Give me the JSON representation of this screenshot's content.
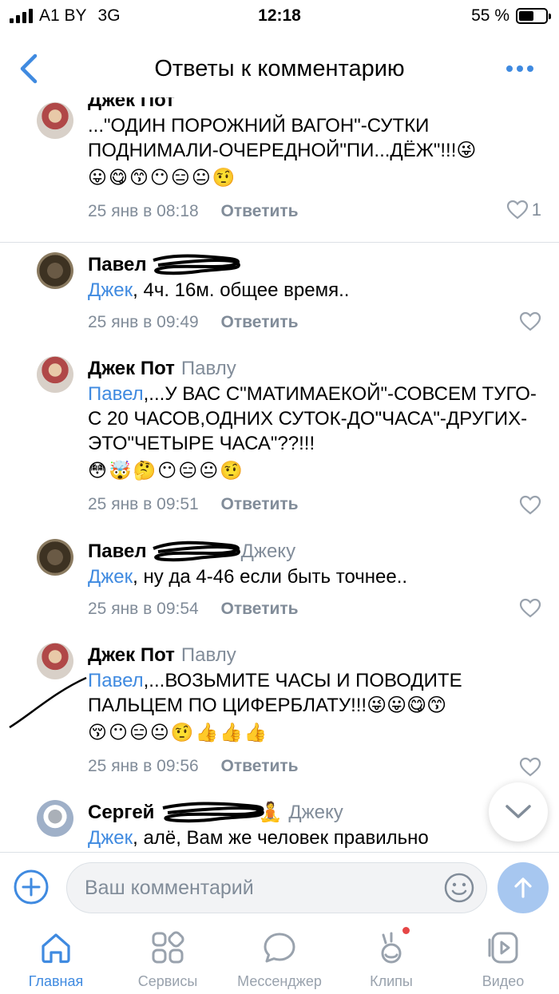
{
  "status_bar": {
    "carrier": "A1 BY",
    "network": "3G",
    "time": "12:18",
    "battery_text": "55 %",
    "battery_level": 0.55
  },
  "header": {
    "title": "Ответы к комментарию",
    "icons": {
      "back": "chevron-left-icon",
      "more": "more-horizontal-icon"
    }
  },
  "comments": [
    {
      "author": "Джек Пот",
      "reply_to": "",
      "mention": "",
      "text": "...\"ОДИН ПОРОЖНИЙ ВАГОН\"-СУТКИ ПОДНИМАЛИ-ОЧЕРЕДНОЙ\"ПИ...ДЁЖ\"!!!😜",
      "emojis": "😛😋😙😶😑😐🤨",
      "date": "25 янв в 08:18",
      "reply_label": "Ответить",
      "likes": "1"
    },
    {
      "author": "Павел",
      "reply_to": "",
      "mention": "Джек",
      "text": ", 4ч. 16м. общее время..",
      "emojis": "",
      "date": "25 янв в 09:49",
      "reply_label": "Ответить",
      "likes": ""
    },
    {
      "author": "Джек Пот",
      "reply_to": "Павлу",
      "mention": "Павел",
      "text": ",...У ВАС С\"МАТИМАЕКОЙ\"-СОВСЕМ ТУГО-С 20 ЧАСОВ,ОДНИХ СУТОК-ДО\"ЧАСА\"-ДРУГИХ-ЭТО\"ЧЕТЫРЕ ЧАСА\"??!!!",
      "emojis": "😳🤯🤔😶😑😐🤨",
      "date": "25 янв в 09:51",
      "reply_label": "Ответить",
      "likes": ""
    },
    {
      "author": "Павел",
      "reply_to": "Джеку",
      "mention": "Джек",
      "text": ", ну да 4-46 если быть точнее..",
      "emojis": "",
      "date": "25 янв в 09:54",
      "reply_label": "Ответить",
      "likes": ""
    },
    {
      "author": "Джек Пот",
      "reply_to": "Павлу",
      "mention": "Павел",
      "text": ",...ВОЗЬМИТЕ ЧАСЫ И ПОВОДИТЕ ПАЛЬЦЕМ ПО ЦИФЕРБЛАТУ!!!😜😛😋😙",
      "emojis": "😚😶😑😐🤨👍👍👍",
      "date": "25 янв в 09:56",
      "reply_label": "Ответить",
      "likes": ""
    },
    {
      "author": "Сергей",
      "author_emoji": "🧘",
      "reply_to": "Джеку",
      "mention": "Джек",
      "text": ", алё, Вам же человек правильно",
      "emojis": "",
      "date": "",
      "reply_label": "",
      "likes": ""
    }
  ],
  "composer": {
    "placeholder": "Ваш комментарий",
    "icons": {
      "add": "plus-circle-icon",
      "emoji": "smile-icon",
      "send": "arrow-up-icon"
    }
  },
  "tabbar": {
    "items": [
      {
        "label": "Главная",
        "icon": "home-icon",
        "active": true
      },
      {
        "label": "Сервисы",
        "icon": "services-icon"
      },
      {
        "label": "Мессенджер",
        "icon": "chat-icon"
      },
      {
        "label": "Клипы",
        "icon": "clips-icon",
        "badge": true
      },
      {
        "label": "Видео",
        "icon": "video-icon"
      }
    ]
  },
  "colors": {
    "accent": "#3f8ae0",
    "secondary_text": "#818c99",
    "tab_inactive": "#99a2ad",
    "divider": "#dce1e6",
    "badge": "#e64646"
  }
}
